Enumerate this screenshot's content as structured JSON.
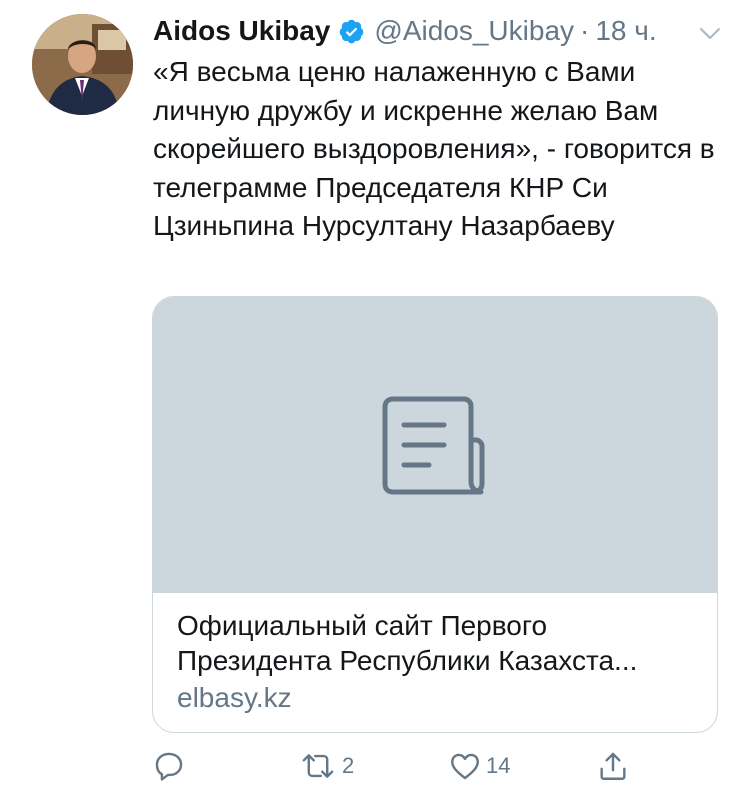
{
  "tweet": {
    "author": {
      "name": "Aidos Ukibay",
      "handle": "@Aidos_Ukibay",
      "separator": "·",
      "time": "18 ч.",
      "verified": true
    },
    "text": "«Я весьма ценю налаженную с Вами личную дружбу и искренне желаю Вам скорейшего выздоровления», - говорится в телеграмме Председателя КНР Си Цзиньпина Нурсултану Назарбаеву",
    "card": {
      "title": "Официальный сайт Первого Президента Республики Казахста...",
      "domain": "elbasy.kz",
      "placeholder_icon": "document-icon"
    },
    "actions": {
      "reply_count": "",
      "retweet_count": "2",
      "like_count": "14"
    }
  },
  "colors": {
    "verified_blue": "#1da1f2",
    "secondary_text": "#657786",
    "card_placeholder": "#ccd6dd",
    "icon_gray": "#657786"
  }
}
